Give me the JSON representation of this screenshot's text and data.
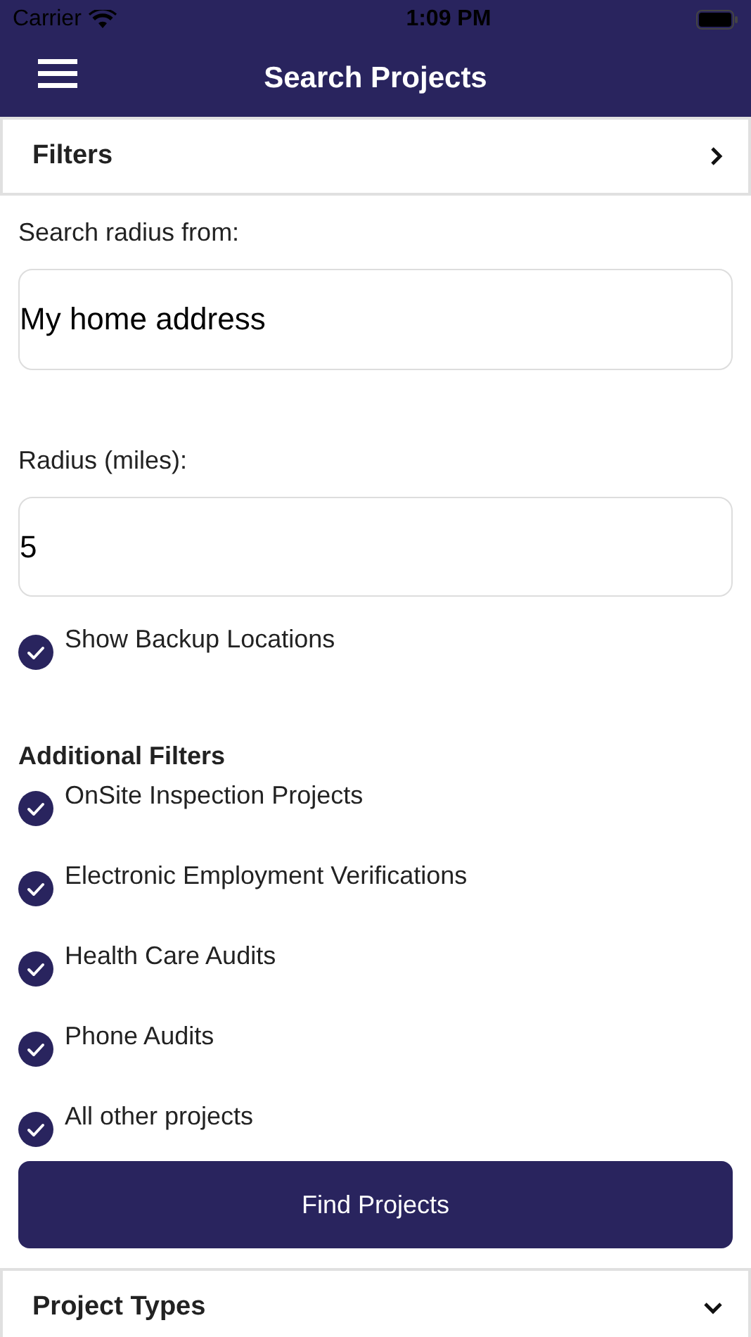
{
  "status_bar": {
    "carrier": "Carrier",
    "time": "1:09 PM"
  },
  "nav": {
    "title": "Search Projects"
  },
  "sections": [
    {
      "title": "Filters",
      "expanded": false
    },
    {
      "title": "Project Types",
      "expanded": true
    }
  ],
  "search_from": {
    "label": "Search radius from:",
    "value": "My home address"
  },
  "radius": {
    "label": "Radius (miles):",
    "value": "5"
  },
  "backup": {
    "label": "Show Backup Locations",
    "checked": true
  },
  "additional_filters": {
    "title": "Additional Filters",
    "items": [
      {
        "label": "OnSite Inspection Projects",
        "checked": true
      },
      {
        "label": "Electronic Employment Verifications",
        "checked": true
      },
      {
        "label": "Health Care Audits",
        "checked": true
      },
      {
        "label": "Phone Audits",
        "checked": true
      },
      {
        "label": "All other projects",
        "checked": true
      }
    ]
  },
  "find_button": "Find Projects"
}
